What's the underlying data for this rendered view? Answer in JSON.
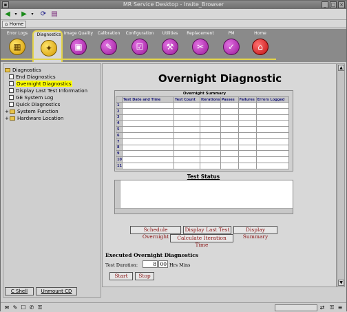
{
  "window": {
    "title": "MR Service Desktop - Insite_Browser"
  },
  "tabs": {
    "home": "Home"
  },
  "nav": [
    {
      "label": "Error Logs",
      "icon": "grid-icon",
      "glyph": "▦"
    },
    {
      "label": "Diagnostics",
      "icon": "wrench-icon",
      "glyph": "✦"
    },
    {
      "label": "Image Quality",
      "icon": "monitor-icon",
      "glyph": "▣"
    },
    {
      "label": "Calibration",
      "icon": "pen-icon",
      "glyph": "✎"
    },
    {
      "label": "Configuration",
      "icon": "checklist-icon",
      "glyph": "☑"
    },
    {
      "label": "Utilities",
      "icon": "toolbox-icon",
      "glyph": "⚒"
    },
    {
      "label": "Replacement",
      "icon": "tools-icon",
      "glyph": "✂"
    },
    {
      "label": "PM",
      "icon": "clipboard-icon",
      "glyph": "✓"
    },
    {
      "label": "Home",
      "icon": "house-icon",
      "glyph": "⌂"
    }
  ],
  "tree": {
    "root": "Diagnostics",
    "items": [
      "End Diagnostics",
      "Overnight Diagnostics",
      "Display Last Test Information",
      "GE System Log",
      "Quick Diagnostics"
    ],
    "folders": [
      "System Function",
      "Hardware Location"
    ]
  },
  "left_buttons": {
    "shell": "C Shell",
    "unmount": "Unmount CD"
  },
  "main": {
    "title": "Overnight Diagnostic",
    "summary_title": "Overnight Summary",
    "columns": [
      "Test Date and Time",
      "Test Count",
      "Iterations",
      "Passes",
      "Failures",
      "Errors Logged"
    ],
    "rows": [
      "1",
      "2",
      "3",
      "4",
      "5",
      "6",
      "7",
      "8",
      "9",
      "10",
      "11"
    ],
    "test_status_label": "Test Status",
    "buttons": {
      "schedule": "Schedule Overnight",
      "display_last": "Display Last Test",
      "display_summary": "Display Summary",
      "calc_iter": "Calculate Iteration Time"
    },
    "executed_label": "Executed Overnight Diagnostics",
    "duration_label": "Test Duration:",
    "duration_hours": "8",
    "duration_mins": "00",
    "duration_units": "Hrs Mins",
    "start": "Start",
    "stop": "Stop"
  }
}
